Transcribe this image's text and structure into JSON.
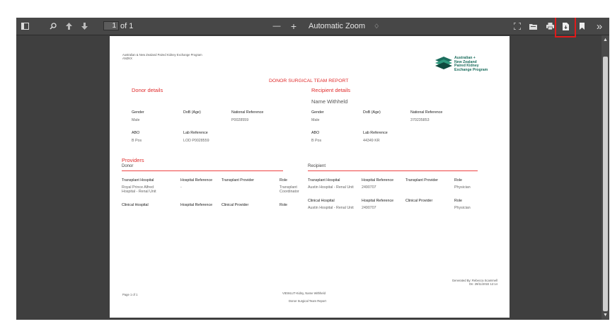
{
  "toolbar": {
    "page_number": "1",
    "page_count_label": "of 1",
    "zoom_out": "—",
    "zoom_in": "+",
    "zoom_level": "Automatic Zoom",
    "zoom_caret": "♢",
    "more": "»"
  },
  "doc": {
    "org_line1": "Australian & New Zealand Paired Kidney Exchange Program",
    "org_line2": "ANZKX",
    "logo_text": "Australian +\nNew Zealand\nPaired Kidney\nExchange Program",
    "report_title": "DONOR SURGICAL TEAM REPORT",
    "donor": {
      "heading": "Donor details",
      "gender_label": "Gender",
      "gender": "Male",
      "dob_label": "DoB (Age)",
      "natref_label": "National Reference",
      "natref": "P0028559",
      "abo_label": "ABO",
      "abo": "B Pos",
      "labref_label": "Lab Reference",
      "labref": "LOD P0028559"
    },
    "recipient": {
      "heading": "Recipient details",
      "name": "Name Withheld",
      "gender_label": "Gender",
      "gender": "Male",
      "dob_label": "DoB (Age)",
      "natref_label": "National Reference",
      "natref": "370235853",
      "abo_label": "ABO",
      "abo": "B Pos",
      "labref_label": "Lab Reference",
      "labref": "44349 KR"
    },
    "providers": {
      "heading": "Providers",
      "donor_sub": "Donor",
      "recipient_sub": "Recipient",
      "col_transplant_hospital": "Transplant Hospital",
      "col_hospital_reference": "Hospital Reference",
      "col_transplant_provider": "Transplant Provider",
      "col_role": "Role",
      "col_clinical_hospital": "Clinical Hospital",
      "col_clinical_provider": "Clinical Provider",
      "d_hosp": "Royal Prince Alfred\nHospital - Renal Unit",
      "d_ref": "-",
      "d_role": "Transplant\nCoordinator",
      "r_hosp": "Austin Hospital - Renal Unit",
      "r_ref": "2490707",
      "r_role": "Physician",
      "r_clin_hosp": "Austin Hospital - Renal Unit",
      "r_clin_ref": "2490707",
      "r_clin_role": "Physician"
    },
    "footer": {
      "page": "Page 1 of 1",
      "center1": "VIEWLUT-Kidny, Name Withheld",
      "center2": "Donor Surgical Team Report",
      "generated1": "Generated By: Rebecca Scammell",
      "generated2": "On: 29/11/2022 12:14"
    }
  }
}
